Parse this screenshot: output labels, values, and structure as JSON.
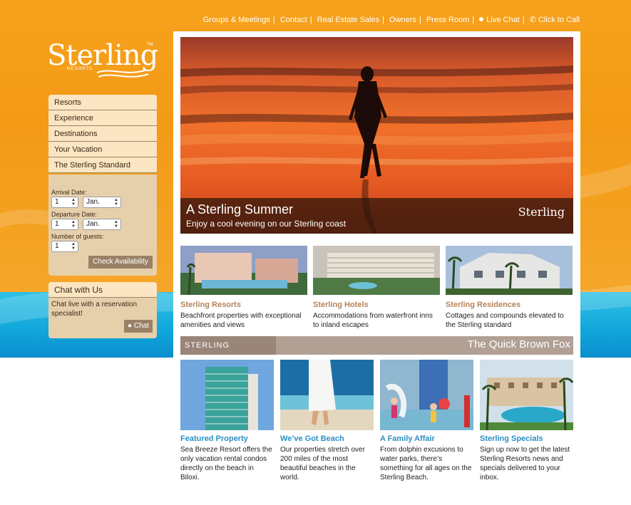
{
  "top_nav": {
    "links": [
      "Groups & Meetings",
      "Contact",
      "Real Estate Sales",
      "Owners",
      "Press Room"
    ],
    "live_chat": "Live Chat",
    "click_to_call": "Click to Call"
  },
  "logo": {
    "word": "Sterling",
    "tm": "TM",
    "sub": "RESORTS"
  },
  "menu": {
    "items": [
      "Resorts",
      "Experience",
      "Destinations",
      "Your Vacation",
      "The Sterling Standard"
    ]
  },
  "booking": {
    "arrival_label": "Arrival Date:",
    "arrival_day": "1",
    "arrival_month": "Jan.",
    "departure_label": "Departure Date:",
    "departure_day": "1",
    "departure_month": "Jan.",
    "guests_label": "Number of guests:",
    "guests": "1",
    "check_button": "Check Availability"
  },
  "chat": {
    "title": "Chat with Us",
    "description": "Chat live with a reservation specialist!",
    "button": "Chat"
  },
  "hero": {
    "title": "A Sterling Summer",
    "subtitle": "Enjoy a cool evening on our Sterling coast",
    "logo": "Sterling"
  },
  "features": [
    {
      "title": "Sterling Resorts",
      "desc": "Beachfront properties with exceptional amenities and views"
    },
    {
      "title": "Sterling Hotels",
      "desc": "Accommodations from waterfront inns to inland escapes"
    },
    {
      "title": "Sterling Residences",
      "desc": "Cottages and compounds elevated to the Sterling standard"
    }
  ],
  "specials_bar": {
    "label": "STERLING SPECIALS",
    "tagline": "The Quick Brown Fox"
  },
  "specials": [
    {
      "title": "Featured Property",
      "desc": "Sea Breeze Resort offers the only vacation rental condos directly on the beach in Biloxi."
    },
    {
      "title": "We’ve Got Beach",
      "desc": "Our properties stretch over 200 miles of the most beautiful beaches in the world."
    },
    {
      "title": "A Family Affair",
      "desc": "From dolphin excusions to water parks, there’s something for all ages on the Sterling Beach."
    },
    {
      "title": "Sterling Specials",
      "desc": "Sign up now to get the latest Sterling Resorts news and specials delivered to your inbox."
    }
  ],
  "colors": {
    "orange": "#f7a21c",
    "blue": "#10a6da",
    "menu_bg": "#fbe5c2",
    "feature_title": "#b48458",
    "special_title": "#2b8fc4"
  }
}
